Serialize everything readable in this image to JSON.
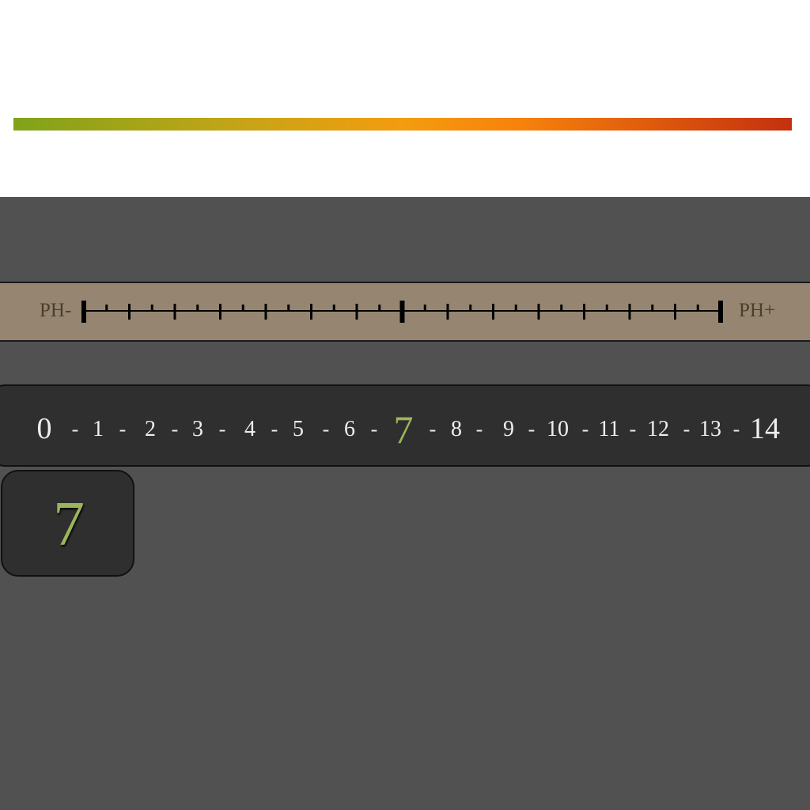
{
  "gradient": {
    "colors": [
      "#7fa31a",
      "#c8a417",
      "#f39c0f",
      "#f7820c",
      "#c4300e"
    ]
  },
  "ruler": {
    "left_label": "PH-",
    "right_label": "PH+",
    "minor_ticks": 28,
    "major_ticks_at": [
      0,
      14,
      28
    ]
  },
  "scale": {
    "values": [
      "0",
      "1",
      "2",
      "3",
      "4",
      "5",
      "6",
      "7",
      "8",
      "9",
      "10",
      "11",
      "12",
      "13",
      "14"
    ],
    "separator": "-",
    "selected": "7",
    "text_color": "#eeeeee",
    "selected_color": "#9cb45a"
  },
  "current_value": {
    "label": "7",
    "color": "#9cb45a"
  }
}
